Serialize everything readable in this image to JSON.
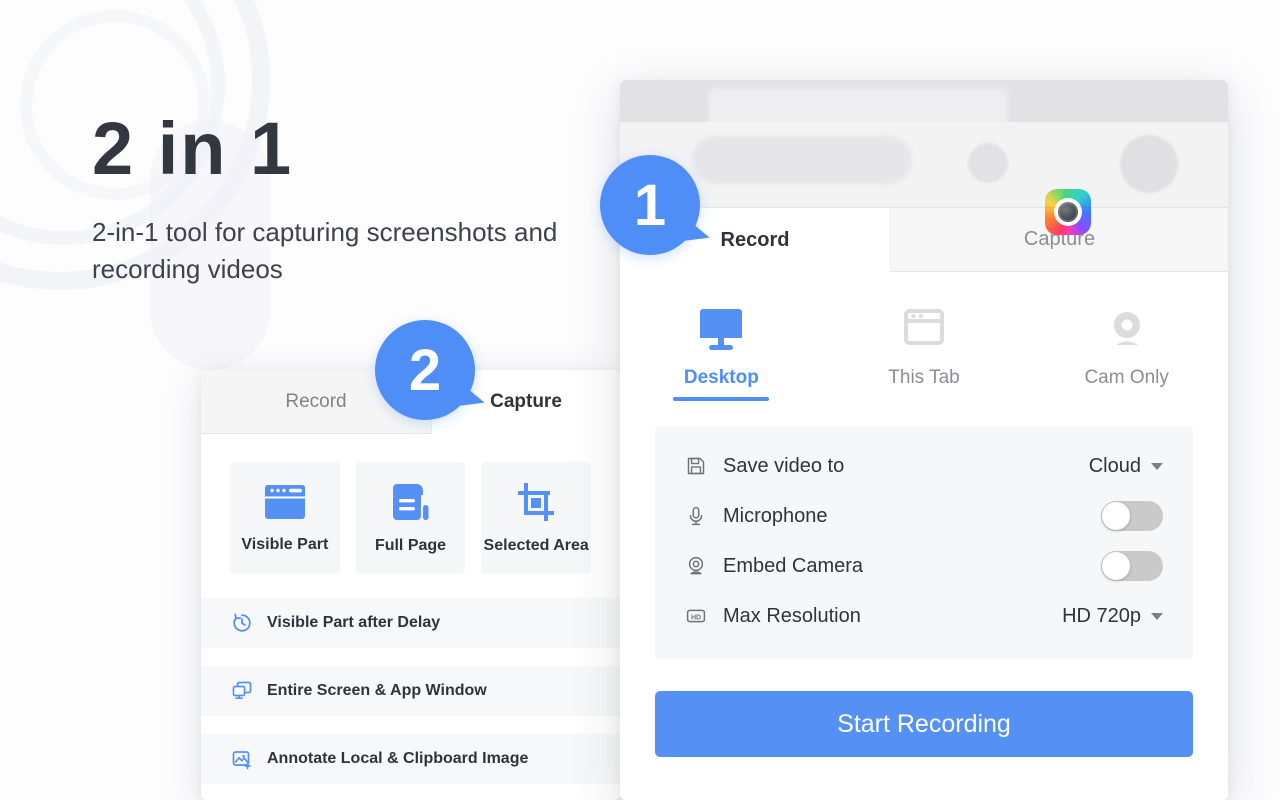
{
  "hero": {
    "title": "2 in 1",
    "subtitle": "2-in-1 tool for capturing screenshots and recording videos"
  },
  "callouts": [
    {
      "name": "callout-1",
      "label": "1"
    },
    {
      "name": "callout-2",
      "label": "2"
    }
  ],
  "colors": {
    "accent": "#4f8ef7",
    "button": "#5590f5",
    "text": "#2f343c",
    "muted": "#8c8e94",
    "panel_bg": "#f6f7f8"
  },
  "record_window": {
    "browser_chrome": {
      "extension_icon": "camera-extension-icon",
      "profile_avatar": "avatar",
      "menu_dot": "menu-dot"
    },
    "tabs": [
      {
        "label": "Record",
        "active": true
      },
      {
        "label": "Capture",
        "active": false
      }
    ],
    "modes": [
      {
        "label": "Desktop",
        "icon": "monitor-icon",
        "active": true
      },
      {
        "label": "This Tab",
        "icon": "browser-window-icon",
        "active": false
      },
      {
        "label": "Cam Only",
        "icon": "webcam-icon",
        "active": false
      }
    ],
    "settings": [
      {
        "icon": "floppy-disk-icon",
        "label": "Save video to",
        "control": "dropdown",
        "value": "Cloud"
      },
      {
        "icon": "microphone-icon",
        "label": "Microphone",
        "control": "toggle",
        "value": "off"
      },
      {
        "icon": "webcam-icon",
        "label": "Embed Camera",
        "control": "toggle",
        "value": "off"
      },
      {
        "icon": "hd-badge-icon",
        "label": "Max Resolution",
        "control": "dropdown",
        "value": "HD 720p"
      }
    ],
    "primary_button": "Start Recording"
  },
  "capture_window": {
    "tabs": [
      {
        "label": "Record",
        "active": false
      },
      {
        "label": "Capture",
        "active": true
      }
    ],
    "tiles": [
      {
        "label": "Visible Part",
        "icon": "browser-visible-part-icon"
      },
      {
        "label": "Full Page",
        "icon": "full-page-icon"
      },
      {
        "label": "Selected Area",
        "icon": "crop-icon"
      }
    ],
    "rows": [
      {
        "label": "Visible Part after Delay",
        "icon": "clock-delay-icon"
      },
      {
        "label": "Entire Screen & App Window",
        "icon": "screen-window-icon"
      },
      {
        "label": "Annotate Local & Clipboard Image",
        "icon": "annotate-image-icon"
      }
    ]
  }
}
